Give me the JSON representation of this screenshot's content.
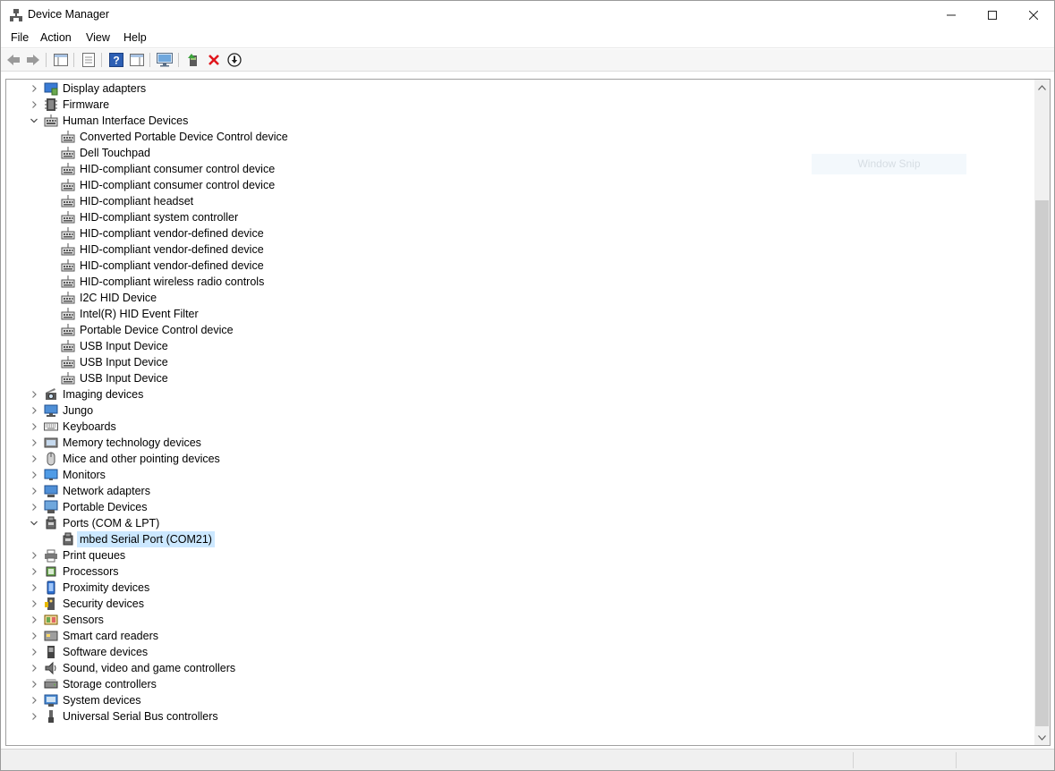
{
  "window": {
    "title": "Device Manager",
    "controls": {
      "minimize": "—",
      "maximize": "☐",
      "close": "✕"
    }
  },
  "menu": [
    "File",
    "Action",
    "View",
    "Help"
  ],
  "toolbar": [
    "back-icon",
    "forward-icon",
    "show-hide-console-tree-icon",
    "properties-icon",
    "help-icon",
    "action-pane-icon",
    "scan-hardware-icon",
    "update-driver-icon",
    "uninstall-device-icon",
    "disable-device-icon"
  ],
  "tree": [
    {
      "label": "Display adapters",
      "expanded": false,
      "icon": "display-adapter-icon"
    },
    {
      "label": "Firmware",
      "expanded": false,
      "icon": "firmware-icon"
    },
    {
      "label": "Human Interface Devices",
      "expanded": true,
      "icon": "hid-icon",
      "children": [
        "Converted Portable Device Control device",
        "Dell Touchpad",
        "HID-compliant consumer control device",
        "HID-compliant consumer control device",
        "HID-compliant headset",
        "HID-compliant system controller",
        "HID-compliant vendor-defined device",
        "HID-compliant vendor-defined device",
        "HID-compliant vendor-defined device",
        "HID-compliant wireless radio controls",
        "I2C HID Device",
        "Intel(R) HID Event Filter",
        "Portable Device Control device",
        "USB Input Device",
        "USB Input Device",
        "USB Input Device"
      ]
    },
    {
      "label": "Imaging devices",
      "expanded": false,
      "icon": "camera-icon"
    },
    {
      "label": "Jungo",
      "expanded": false,
      "icon": "computer-icon"
    },
    {
      "label": "Keyboards",
      "expanded": false,
      "icon": "keyboard-icon"
    },
    {
      "label": "Memory technology devices",
      "expanded": false,
      "icon": "memory-icon"
    },
    {
      "label": "Mice and other pointing devices",
      "expanded": false,
      "icon": "mouse-icon"
    },
    {
      "label": "Monitors",
      "expanded": false,
      "icon": "monitor-icon"
    },
    {
      "label": "Network adapters",
      "expanded": false,
      "icon": "network-icon"
    },
    {
      "label": "Portable Devices",
      "expanded": false,
      "icon": "portable-device-icon"
    },
    {
      "label": "Ports (COM & LPT)",
      "expanded": true,
      "icon": "port-icon",
      "children": [
        "mbed Serial Port (COM21)"
      ],
      "selected_child": 0
    },
    {
      "label": "Print queues",
      "expanded": false,
      "icon": "printer-icon"
    },
    {
      "label": "Processors",
      "expanded": false,
      "icon": "processor-icon"
    },
    {
      "label": "Proximity devices",
      "expanded": false,
      "icon": "proximity-icon"
    },
    {
      "label": "Security devices",
      "expanded": false,
      "icon": "security-icon"
    },
    {
      "label": "Sensors",
      "expanded": false,
      "icon": "sensor-icon"
    },
    {
      "label": "Smart card readers",
      "expanded": false,
      "icon": "smartcard-icon"
    },
    {
      "label": "Software devices",
      "expanded": false,
      "icon": "software-icon"
    },
    {
      "label": "Sound, video and game controllers",
      "expanded": false,
      "icon": "speaker-icon"
    },
    {
      "label": "Storage controllers",
      "expanded": false,
      "icon": "storage-icon"
    },
    {
      "label": "System devices",
      "expanded": false,
      "icon": "system-icon"
    },
    {
      "label": "Universal Serial Bus controllers",
      "expanded": false,
      "icon": "usb-icon"
    }
  ],
  "overlay": {
    "ghost_text": "Window Snip"
  },
  "colors": {
    "selection": "#cce8ff",
    "scrollbar_thumb": "#cdcdcd"
  }
}
